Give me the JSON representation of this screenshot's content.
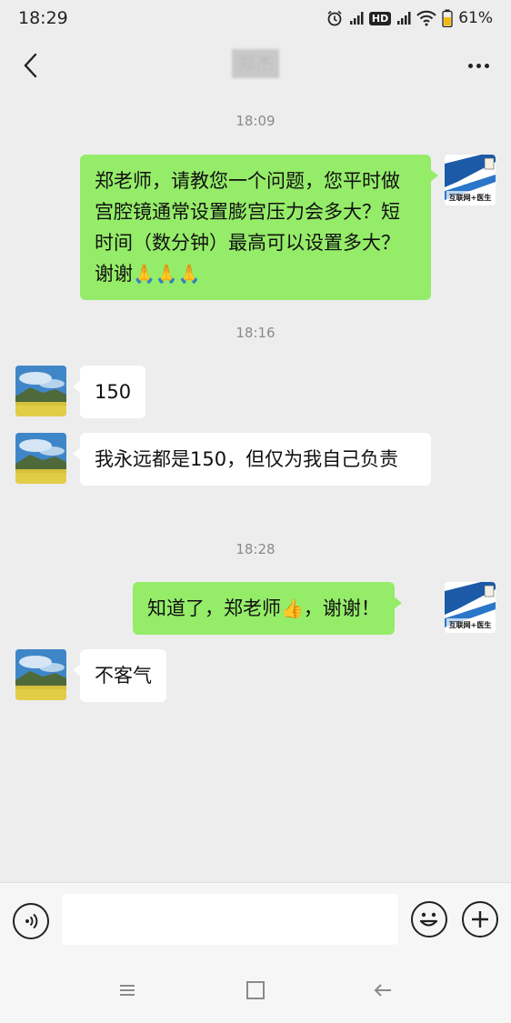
{
  "status_bar": {
    "time": "18:29",
    "hd_label": "HD",
    "battery_text": "61%"
  },
  "header": {
    "title": "郑杰",
    "back_icon": "chevron-left-icon",
    "more_icon": "more-dots-icon"
  },
  "messages": [
    {
      "type": "timestamp",
      "text": "18:09"
    },
    {
      "type": "message",
      "sender": "self",
      "text": "郑老师，请教您一个问题，您平时做宫腔镜通常设置膨宫压力会多大？短时间（数分钟）最高可以设置多大？谢谢",
      "emoji": "🙏🙏🙏"
    },
    {
      "type": "timestamp",
      "text": "18:16"
    },
    {
      "type": "message",
      "sender": "other",
      "text": "150"
    },
    {
      "type": "message",
      "sender": "other",
      "text": "我永远都是150，但仅为我自己负责"
    },
    {
      "type": "timestamp",
      "text": "18:28"
    },
    {
      "type": "message",
      "sender": "self",
      "text_before": "知道了，郑老师",
      "emoji": "👍",
      "text_after": "，谢谢！"
    },
    {
      "type": "message",
      "sender": "other",
      "text": "不客气"
    }
  ],
  "self_avatar_label": "互联网+医生",
  "input_bar": {
    "voice_icon": "voice-icon",
    "input_value": "",
    "emoji_icon": "smiley-icon",
    "plus_icon": "plus-circle-icon"
  },
  "system_nav": {
    "menu_icon": "menu-icon",
    "home_icon": "home-square-icon",
    "back_icon": "back-arrow-icon"
  },
  "colors": {
    "background": "#ededed",
    "self_bubble": "#95ec69",
    "other_bubble": "#ffffff",
    "timestamp_text": "#8a8a8a"
  }
}
